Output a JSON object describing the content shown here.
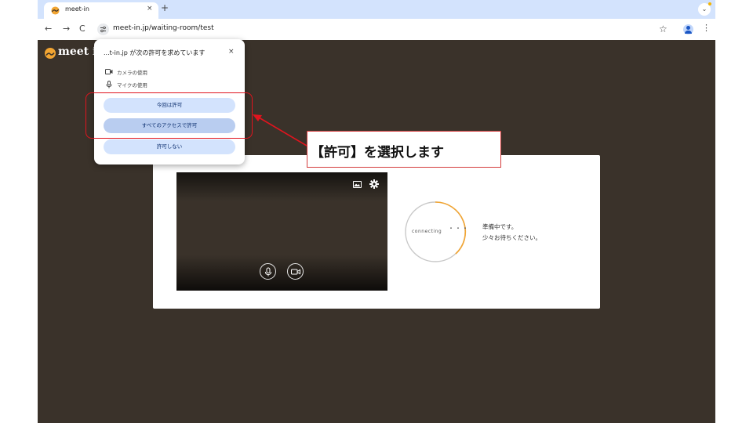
{
  "browser": {
    "tab_title": "meet-in",
    "tab_close": "×",
    "new_tab": "+",
    "tab_menu": "⌄",
    "nav_back": "←",
    "nav_forward": "→",
    "nav_reload": "C",
    "url": "meet-in.jp/waiting-room/test",
    "bookmark": "☆",
    "menu": "⋮"
  },
  "app": {
    "logo_text": "meet i",
    "status_line1": "準備中です。",
    "status_line2": "少々お待ちください。",
    "connecting": "connecting",
    "dots": "・・・",
    "colors": {
      "background": "#3a322a",
      "accent": "#f2a532"
    }
  },
  "permission_popup": {
    "title": "...t-in.jp が次の許可を求めています",
    "close": "×",
    "permissions": [
      "カメラの使用",
      "マイクの使用"
    ],
    "buttons": [
      "今回は許可",
      "すべてのアクセスで許可",
      "許可しない"
    ]
  },
  "annotation": {
    "callout": "【許可】を選択します",
    "color": "#e0141e"
  }
}
